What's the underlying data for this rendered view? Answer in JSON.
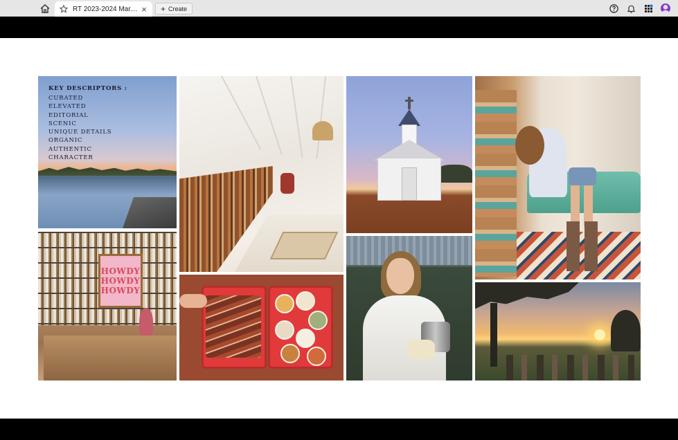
{
  "browser": {
    "tab_title": "RT 2023-2024 Marketi...",
    "create_label": "Create",
    "icons": {
      "home": "home-icon",
      "star": "star-icon",
      "close": "close-icon",
      "plus": "plus-icon",
      "help": "help-icon",
      "notifications": "bell-icon",
      "apps": "apps-grid-icon",
      "avatar": "avatar"
    }
  },
  "slide": {
    "descriptors": {
      "heading": "KEY DESCRIPTORS :",
      "items": [
        "CURATED",
        "ELEVATED",
        "EDITORIAL",
        "SCENIC",
        "UNIQUE DETAILS",
        "ORGANIC",
        "AUTHENTIC",
        "CHARACTER"
      ]
    },
    "poster_lines": [
      "HOWDY",
      "HOWDY",
      "HOWDY"
    ]
  },
  "colors": {
    "chrome": "#e6e6e6",
    "letterbox": "#000000",
    "avatar": "#7b3fc4",
    "tray_red": "#e13a3a",
    "poster_pink": "#f2b7c9"
  }
}
